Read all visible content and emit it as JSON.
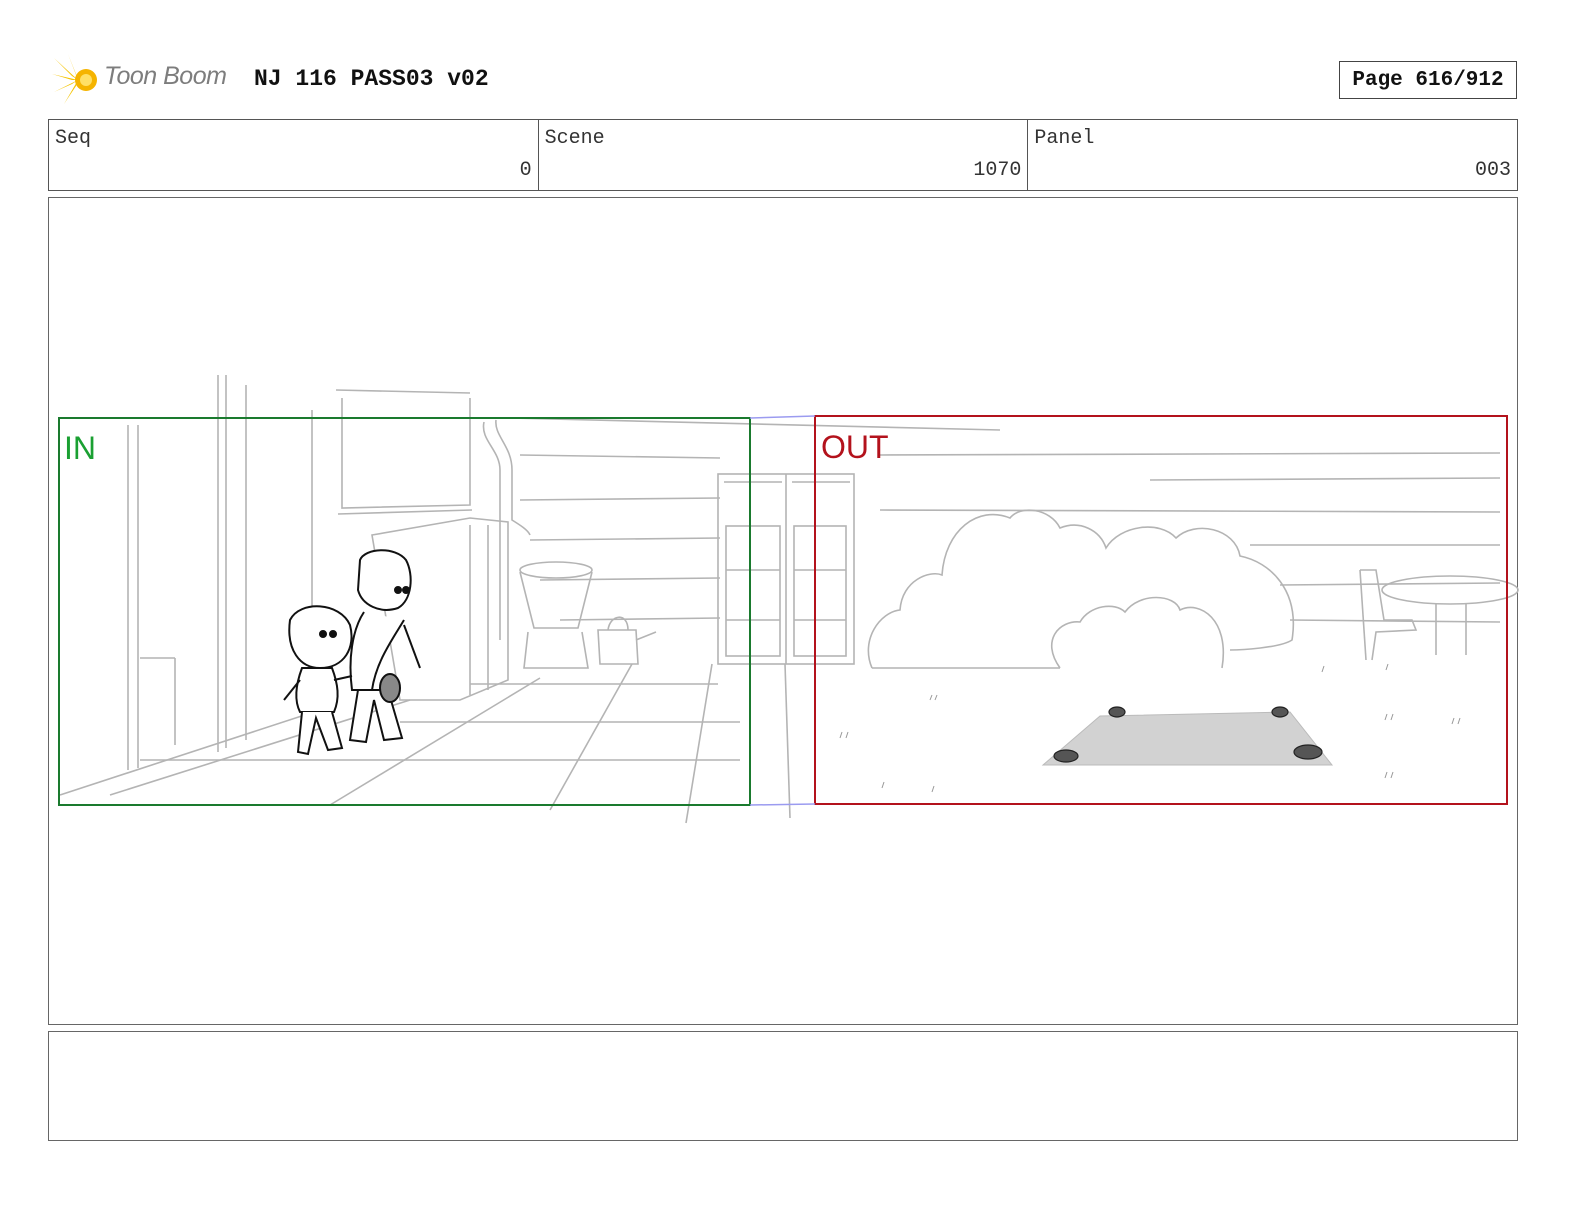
{
  "header": {
    "logo_text": "Toon Boom",
    "title": "NJ 116 PASS03 v02",
    "page": "Page 616/912"
  },
  "info": {
    "seq_label": "Seq",
    "seq_value": "0",
    "scene_label": "Scene",
    "scene_value": "1070",
    "panel_label": "Panel",
    "panel_value": "003"
  },
  "panel": {
    "in_label": "IN",
    "out_label": "OUT",
    "in_color": "#1a7a2e",
    "out_color": "#b3121c"
  },
  "notes": {}
}
